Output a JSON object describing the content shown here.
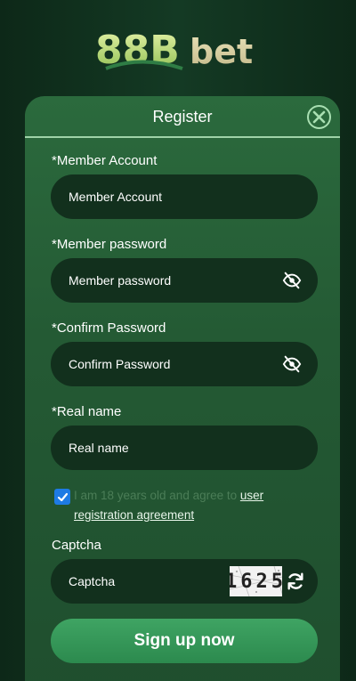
{
  "logo": {
    "text": "88Bbet"
  },
  "panel": {
    "title": "Register"
  },
  "form": {
    "account": {
      "label": "*Member Account",
      "placeholder": "Member Account"
    },
    "password": {
      "label": "*Member password",
      "placeholder": "Member password"
    },
    "confirm": {
      "label": "*Confirm Password",
      "placeholder": "Confirm Password"
    },
    "realname": {
      "label": "*Real name",
      "placeholder": "Real name"
    },
    "agreement": {
      "checked": true,
      "text": "I am 18 years old and agree to ",
      "link": "user registration agreement"
    },
    "captcha": {
      "label": "Captcha",
      "placeholder": "Captcha",
      "code": "1625"
    },
    "submit_label": "Sign up now"
  },
  "colors": {
    "accent": "#2c8a4e",
    "checkbox": "#1e7be4",
    "input_bg": "#12301d"
  },
  "icons": {
    "close": "close-icon",
    "eye": "eye-off-icon",
    "refresh": "refresh-icon",
    "check": "check-icon"
  }
}
